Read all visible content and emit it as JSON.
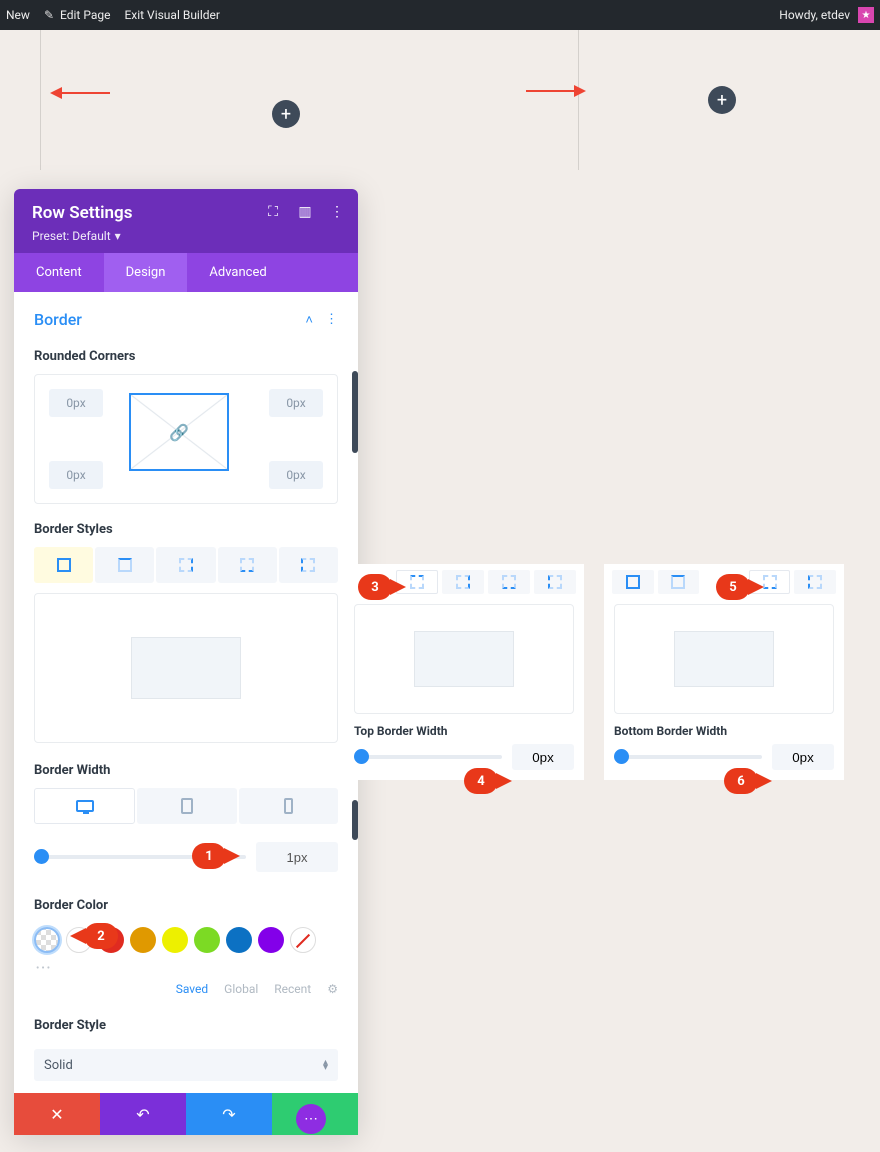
{
  "adminbar": {
    "new": "New",
    "edit_page": "Edit Page",
    "exit_vb": "Exit Visual Builder",
    "howdy": "Howdy, etdev"
  },
  "panel": {
    "title": "Row Settings",
    "preset_label": "Preset: Default",
    "tabs": {
      "content": "Content",
      "design": "Design",
      "advanced": "Advanced"
    },
    "section_border": "Border",
    "rounded_corners_label": "Rounded Corners",
    "rc_value": "0px",
    "border_styles_label": "Border Styles",
    "border_width_label": "Border Width",
    "border_width_value": "1px",
    "border_color_label": "Border Color",
    "palette": {
      "saved": "Saved",
      "global": "Global",
      "recent": "Recent"
    },
    "border_style_label": "Border Style",
    "border_style_value": "Solid"
  },
  "callouts": {
    "top_width_label": "Top Border Width",
    "top_width_value": "0px",
    "bottom_width_label": "Bottom Border Width",
    "bottom_width_value": "0px"
  },
  "pins": {
    "p1": "1",
    "p2": "2",
    "p3": "3",
    "p4": "4",
    "p5": "5",
    "p6": "6"
  }
}
